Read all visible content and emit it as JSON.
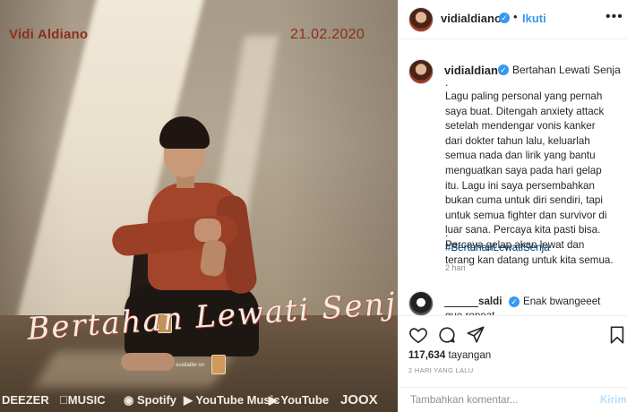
{
  "image": {
    "artist": "Vidi Aldiano",
    "date": "21.02.2020",
    "script_title": "Bertahan Lewati Senja",
    "available_on": "available on",
    "platforms": [
      "DEEZER",
      "MUSIC",
      "Spotify",
      "YouTube Music",
      "YouTube",
      "JOOX"
    ]
  },
  "header": {
    "username": "vidialdiano",
    "dot": "•",
    "follow_label": "Ikuti",
    "more_label": "•••"
  },
  "caption": {
    "username": "vidialdiano",
    "title": "Bertahan Lewati Senja",
    "dot1": ".",
    "body": "Lagu paling personal yang pernah saya buat. Ditengah anxiety attack setelah mendengar vonis kanker dari dokter tahun lalu, keluarlah semua nada dan lirik yang bantu menguatkan saya pada hari gelap itu. Lagu ini saya persembahkan bukan cuma untuk diri sendiri, tapi untuk semua fighter dan survivor di luar sana. Percaya kita pasti bisa. Percaya gelap akan lewat dan terang kan datang untuk kita semua.",
    "dot2": ".",
    "hashtag": "#BertahanLewatiSenja",
    "time_ago": "2 hari"
  },
  "comment": {
    "username_suffix": "saldi",
    "text": "Enak bwangeeet",
    "text_cont": "gue repeat"
  },
  "stats": {
    "views_count": "117,634",
    "views_label": "tayangan",
    "date_label": "2 HARI YANG LALU"
  },
  "comment_box": {
    "placeholder": "Tambahkan komentar...",
    "post_label": "Kirim"
  },
  "colors": {
    "accent": "#3897f0",
    "hashtag": "#00376b",
    "text": "#262626",
    "muted": "#8e8e8e"
  },
  "icons": [
    "heart-icon",
    "comment-icon",
    "share-icon",
    "save-icon",
    "verified-icon",
    "more-options-icon"
  ]
}
